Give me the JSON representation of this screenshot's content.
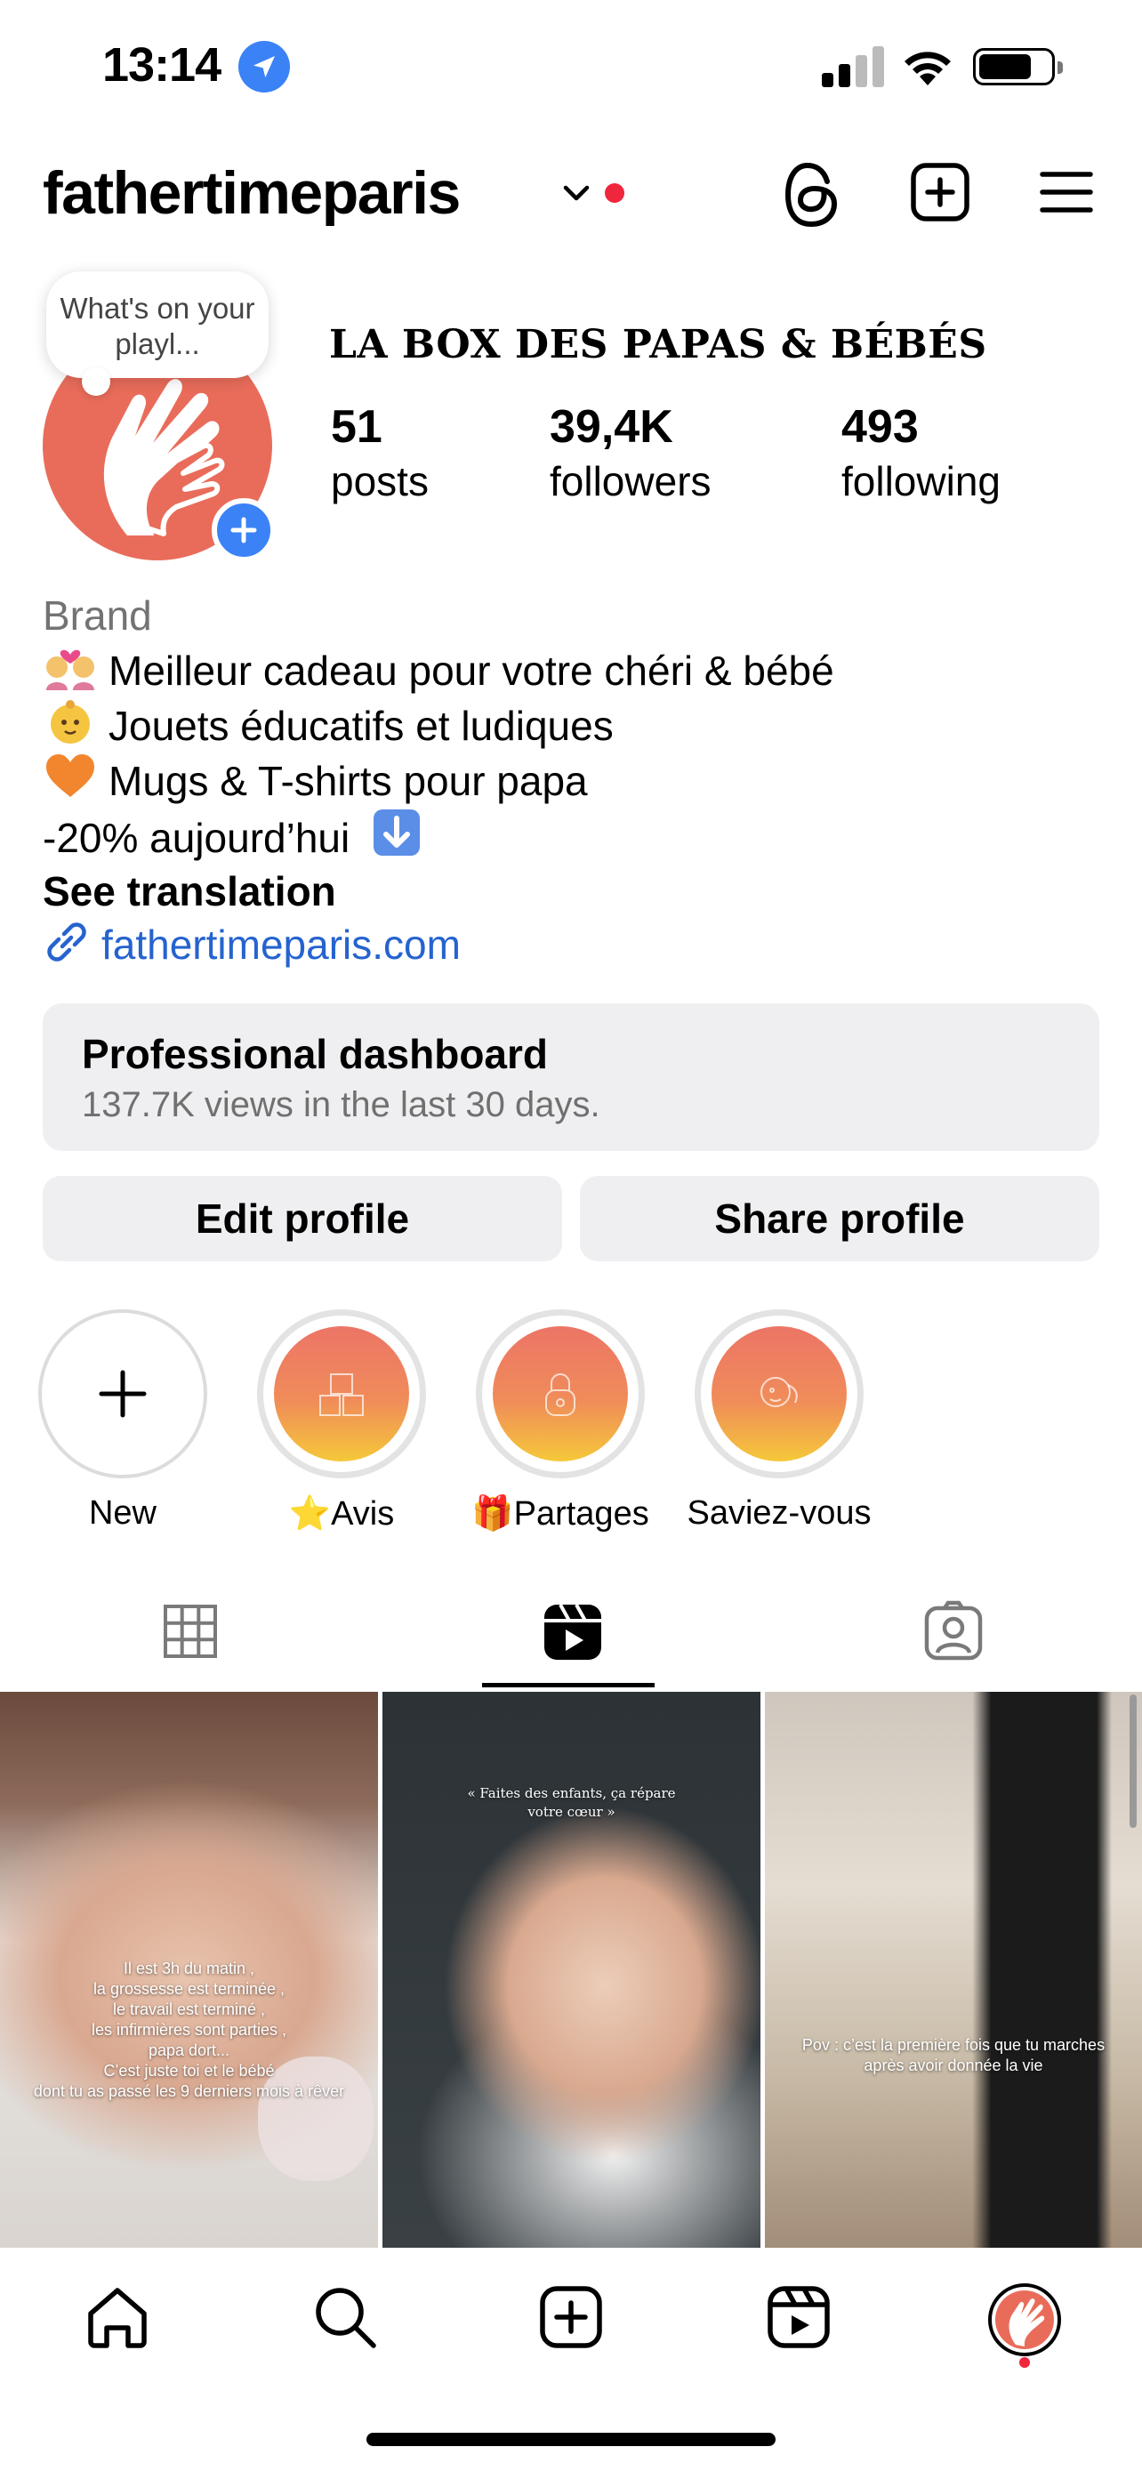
{
  "status_bar": {
    "time": "13:14"
  },
  "header": {
    "username": "fathertimeparis"
  },
  "profile": {
    "note": "What's on your playl...",
    "display_name": "LA BOX DES PAPAS & BÉBÉS",
    "stats": [
      {
        "value": "51",
        "label": "posts"
      },
      {
        "value": "39,4K",
        "label": "followers"
      },
      {
        "value": "493",
        "label": "following"
      }
    ],
    "category": "Brand",
    "bio_lines": [
      "Meilleur cadeau pour votre chéri & bébé",
      "Jouets éducatifs et ludiques",
      "Mugs & T-shirts pour papa",
      "-20% aujourd’hui"
    ],
    "see_translation": "See translation",
    "link": "fathertimeparis.com"
  },
  "dashboard": {
    "title": "Professional dashboard",
    "subtitle": "137.7K views in the last 30 days."
  },
  "buttons": {
    "edit": "Edit profile",
    "share": "Share profile"
  },
  "highlights": [
    {
      "label": "New"
    },
    {
      "label": "Avis",
      "emoji": "⭐"
    },
    {
      "label": "Partages",
      "emoji": "🎁"
    },
    {
      "label": "Saviez-vous"
    }
  ],
  "posts": [
    {
      "caption": [
        "Il est 3h du matin ,",
        "la grossesse est terminée ,",
        "le travail est terminé ,",
        "les infirmières sont parties ,",
        "papa dort...",
        "C’est juste toi et le bébé",
        "dont tu as passé les 9 derniers mois à rêver"
      ]
    },
    {
      "caption": [
        "« Faites des enfants, ça répare",
        "votre cœur »"
      ]
    },
    {
      "caption": [
        "Pov : c’est la première fois que tu marches",
        "après avoir donnée la vie"
      ]
    }
  ],
  "colors": {
    "accent": "#2563cf",
    "avatar": "#e96c5a",
    "notification": "#f0263c",
    "button_bg": "#efeff1"
  }
}
